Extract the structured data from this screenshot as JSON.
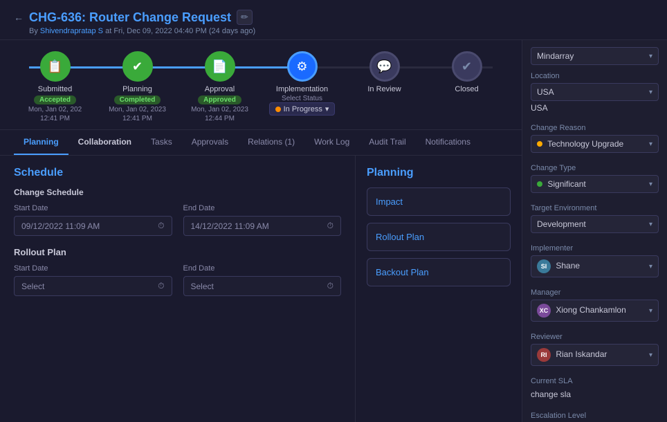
{
  "header": {
    "back_label": "←",
    "title": "CHG-636: Router Change Request",
    "edit_icon": "✏",
    "subtitle_prefix": "By",
    "author": "Shivendrapratap S",
    "subtitle_time": "at Fri, Dec 09, 2022 04:40 PM (24 days ago)"
  },
  "workflow": {
    "steps": [
      {
        "label": "Submitted",
        "icon": "📋",
        "style": "green",
        "badge": "Accepted",
        "badge_class": "badge-accepted",
        "date": "Mon, Jan 02, 202",
        "date2": "12:41 PM"
      },
      {
        "label": "Planning",
        "icon": "✔",
        "style": "green",
        "badge": "Completed",
        "badge_class": "badge-completed",
        "date": "Mon, Jan 02, 2023",
        "date2": "12:41 PM"
      },
      {
        "label": "Approval",
        "icon": "📄",
        "style": "green",
        "badge": "Approved",
        "badge_class": "badge-approved",
        "date": "Mon, Jan 02, 2023",
        "date2": "12:44 PM"
      },
      {
        "label": "Implementation",
        "icon": "⚙",
        "style": "blue",
        "select_status": "Select Status",
        "status_value": "In Progress"
      },
      {
        "label": "In Review",
        "icon": "💬",
        "style": "grey"
      },
      {
        "label": "Closed",
        "icon": "✔",
        "style": "grey-check"
      }
    ]
  },
  "tabs": [
    {
      "label": "Planning",
      "active": true,
      "bold": true
    },
    {
      "label": "Collaboration",
      "active": false,
      "bold": true
    },
    {
      "label": "Tasks",
      "active": false
    },
    {
      "label": "Approvals",
      "active": false
    },
    {
      "label": "Relations (1)",
      "active": false
    },
    {
      "label": "Work Log",
      "active": false
    },
    {
      "label": "Audit Trail",
      "active": false
    },
    {
      "label": "Notifications",
      "active": false
    }
  ],
  "schedule": {
    "section_title": "Schedule",
    "subsection_title": "Change Schedule",
    "start_label": "Start Date",
    "end_label": "End Date",
    "start_value": "09/12/2022 11:09 AM",
    "end_value": "14/12/2022 11:09 AM"
  },
  "rollout": {
    "title": "Rollout Plan",
    "start_label": "Start Date",
    "end_label": "End Date",
    "start_placeholder": "Select",
    "end_placeholder": "Select"
  },
  "planning": {
    "title": "Planning",
    "cards": [
      {
        "title": "Impact"
      },
      {
        "title": "Rollout Plan"
      },
      {
        "title": "Backout Plan"
      }
    ]
  },
  "sidebar": {
    "org_label": "Mindarray",
    "location_label": "Location",
    "location_value": "USA",
    "location_subvalue": "USA",
    "change_reason_label": "Change Reason",
    "change_reason_value": "Technology Upgrade",
    "change_reason_dot": "amber",
    "change_type_label": "Change Type",
    "change_type_value": "Significant",
    "change_type_dot": "green",
    "target_env_label": "Target Environment",
    "target_env_value": "Development",
    "implementer_label": "Implementer",
    "implementer_value": "Shane",
    "implementer_avatar": "SI",
    "manager_label": "Manager",
    "manager_value": "Xiong Chankamlon",
    "manager_avatar": "XC",
    "reviewer_label": "Reviewer",
    "reviewer_value": "Rian Iskandar",
    "reviewer_avatar": "RI",
    "sla_label": "Current SLA",
    "sla_value": "change sla",
    "escalation_label": "Escalation Level"
  }
}
